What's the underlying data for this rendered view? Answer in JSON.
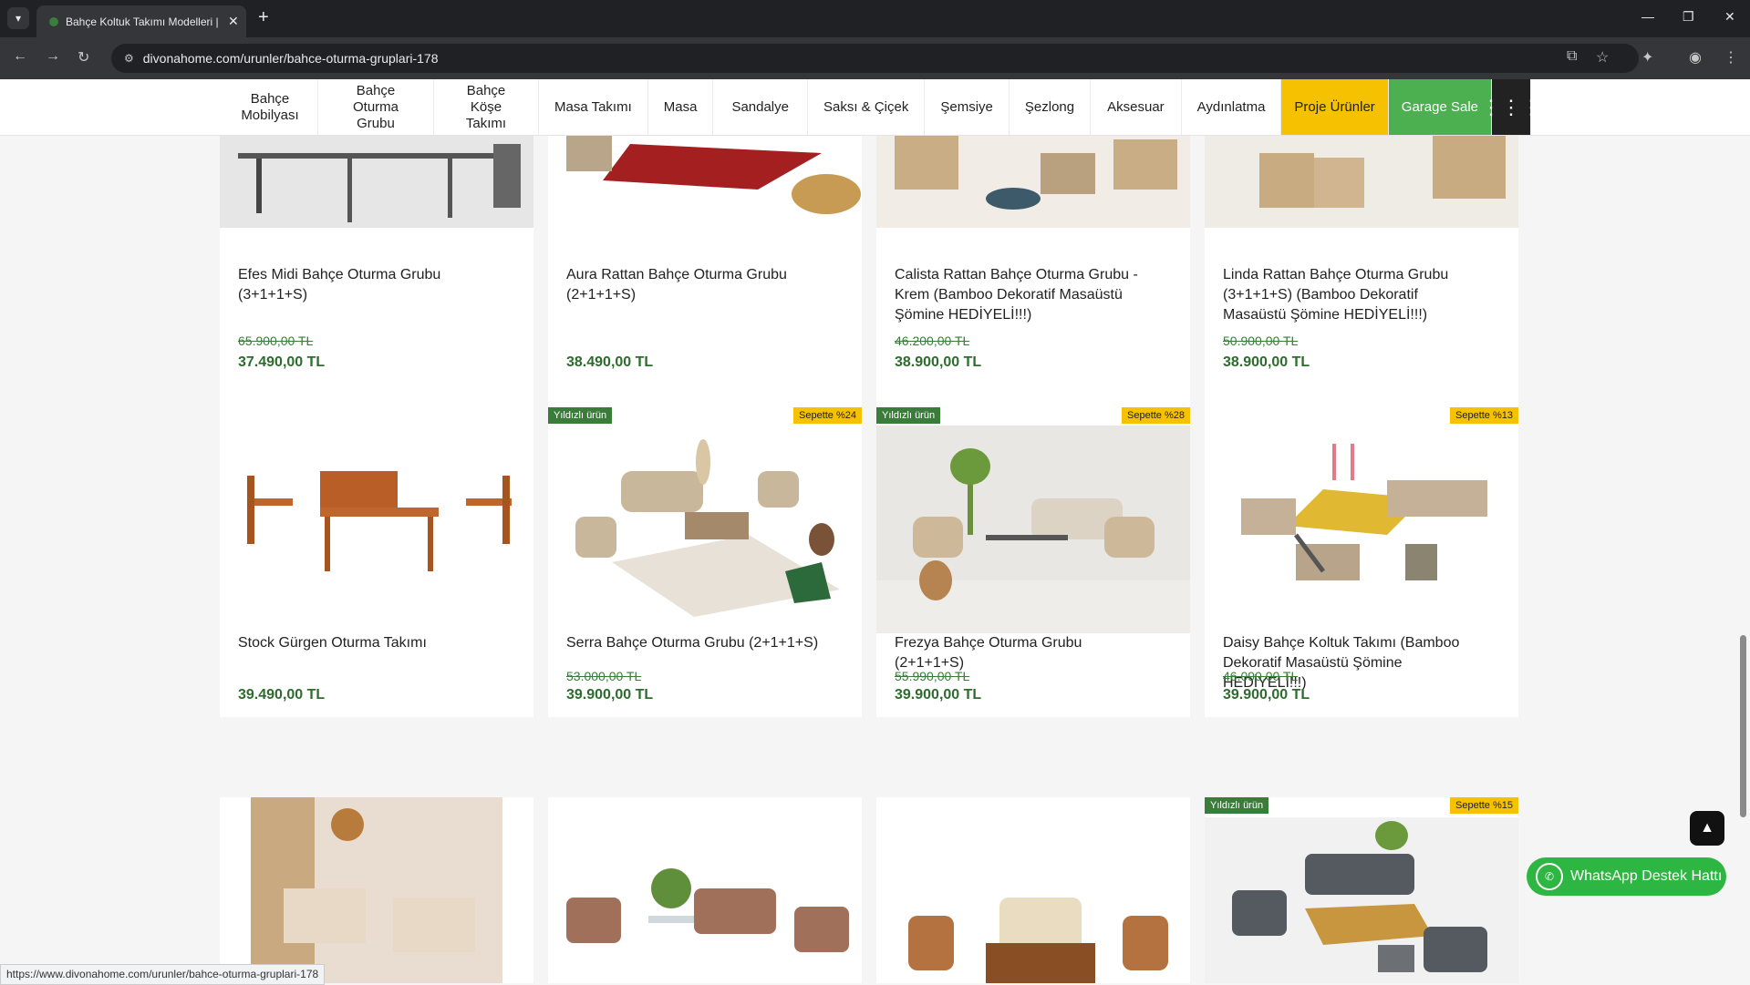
{
  "browser": {
    "tab_title": "Bahçe Koltuk Takımı Modelleri |",
    "url": "divonahome.com/urunler/bahce-oturma-gruplari-178",
    "status_url": "https://www.divonahome.com/urunler/bahce-oturma-gruplari-178"
  },
  "nav": {
    "items": [
      {
        "label": "Bahçe Mobilyası"
      },
      {
        "label": "Bahçe Oturma Grubu"
      },
      {
        "label": "Bahçe Köşe Takımı"
      },
      {
        "label": "Masa Takımı"
      },
      {
        "label": "Masa"
      },
      {
        "label": "Sandalye"
      },
      {
        "label": "Saksı & Çiçek"
      },
      {
        "label": "Şemsiye"
      },
      {
        "label": "Şezlong"
      },
      {
        "label": "Aksesuar"
      },
      {
        "label": "Aydınlatma"
      }
    ],
    "proje": "Proje Ürünler",
    "garage": "Garage Sale"
  },
  "products": [
    {
      "name": "Efes Midi Bahçe Oturma Grubu (3+1+1+S)",
      "old_price": "65.900,00 TL",
      "price": "37.490,00 TL"
    },
    {
      "name": "Aura Rattan Bahçe Oturma Grubu (2+1+1+S)",
      "old_price": "",
      "price": "38.490,00 TL"
    },
    {
      "name": "Calista Rattan Bahçe Oturma Grubu - Krem (Bamboo Dekoratif Masaüstü Şömine HEDİYELİ!!!)",
      "old_price": "46.200,00 TL",
      "price": "38.900,00 TL"
    },
    {
      "name": "Linda Rattan Bahçe Oturma Grubu (3+1+1+S) (Bamboo Dekoratif Masaüstü Şömine HEDİYELİ!!!)",
      "old_price": "50.900,00 TL",
      "price": "38.900,00 TL"
    },
    {
      "name": "Stock Gürgen Oturma Takımı",
      "old_price": "",
      "price": "39.490,00 TL"
    },
    {
      "name": "Serra Bahçe Oturma Grubu (2+1+1+S)",
      "old_price": "53.000,00 TL",
      "price": "39.900,00 TL",
      "badge_star": "Yıldızlı ürün",
      "badge_cart": "Sepette %24"
    },
    {
      "name": "Frezya Bahçe Oturma Grubu (2+1+1+S)",
      "old_price": "55.990,00 TL",
      "price": "39.900,00 TL",
      "badge_star": "Yıldızlı ürün",
      "badge_cart": "Sepette %28"
    },
    {
      "name": "Daisy Bahçe Koltuk Takımı (Bamboo Dekoratif Masaüstü Şömine HEDİYELİ!!!)",
      "old_price": "46.090,00 TL",
      "price": "39.900,00 TL",
      "badge_cart": "Sepette %13"
    }
  ],
  "row3_badges": {
    "star": "Yıldızlı ürün",
    "cart": "Sepette %15"
  },
  "whatsapp": "WhatsApp Destek Hattı",
  "icons": {
    "back": "arrow-left-icon",
    "forward": "arrow-right-icon",
    "reload": "reload-icon",
    "grid": "grid-menu-icon",
    "scrolltop": "chevron-up-icon"
  }
}
